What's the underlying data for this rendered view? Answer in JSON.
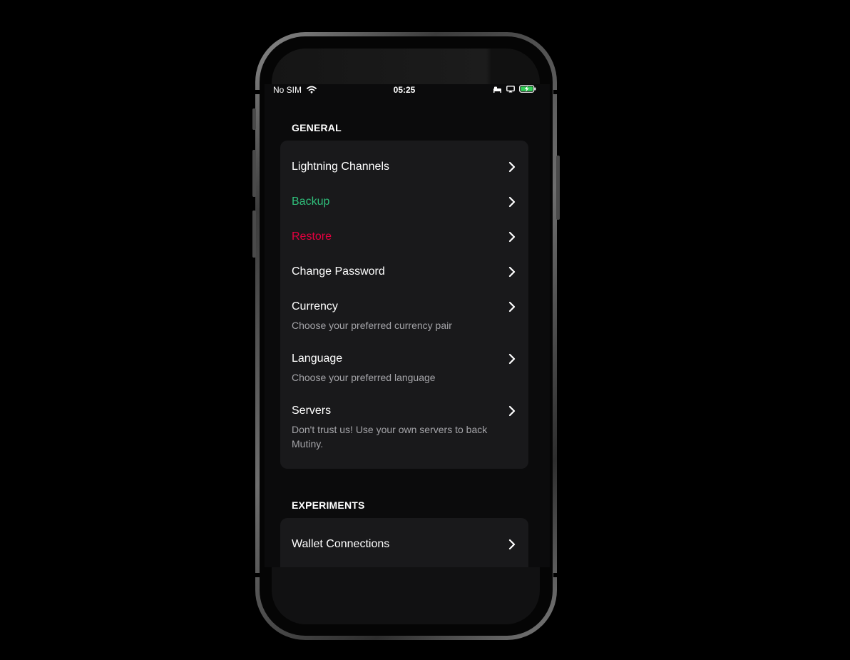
{
  "status_bar": {
    "carrier": "No SIM",
    "time": "05:25",
    "icons": [
      "wifi-icon",
      "bed-icon",
      "screen-mirror-icon",
      "battery-charging-icon"
    ],
    "battery_color": "#33d058"
  },
  "general": {
    "header": "GENERAL",
    "items": [
      {
        "label": "Lightning Channels",
        "color": "#ffffff"
      },
      {
        "label": "Backup",
        "color": "#2fbf7b"
      },
      {
        "label": "Restore",
        "color": "#e4003f"
      },
      {
        "label": "Change Password",
        "color": "#ffffff"
      },
      {
        "label": "Currency",
        "sub": "Choose your preferred currency pair"
      },
      {
        "label": "Language",
        "sub": "Choose your preferred language"
      },
      {
        "label": "Servers",
        "sub": "Don't trust us! Use your own servers to back Mutiny."
      }
    ]
  },
  "experiments": {
    "header": "EXPERIMENTS",
    "items": [
      {
        "label": "Wallet Connections"
      }
    ]
  },
  "colors": {
    "background": "#0b0b0c",
    "card": "#19191b",
    "subtext": "#a4a4a8",
    "accent_green": "#2fbf7b",
    "accent_red": "#e4003f"
  }
}
